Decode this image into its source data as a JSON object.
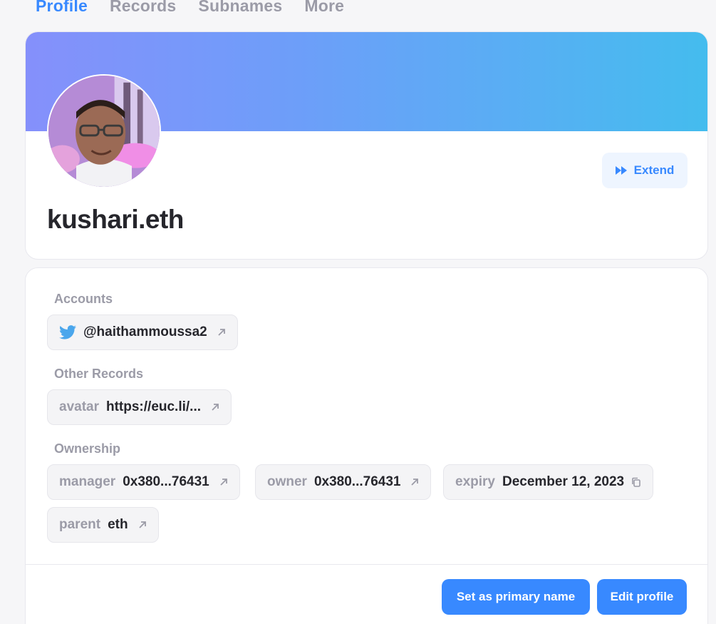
{
  "tabs": [
    {
      "label": "Profile",
      "active": true
    },
    {
      "label": "Records",
      "active": false
    },
    {
      "label": "Subnames",
      "active": false
    },
    {
      "label": "More",
      "active": false
    }
  ],
  "profile": {
    "name": "kushari.eth",
    "extend_label": "Extend",
    "avatar_icon": "profile-photo"
  },
  "accounts": {
    "label": "Accounts",
    "twitter": {
      "icon": "twitter-icon",
      "handle": "@haithammoussa2"
    }
  },
  "other_records": {
    "label": "Other Records",
    "avatar": {
      "key": "avatar",
      "value": "https://euc.li/..."
    }
  },
  "ownership": {
    "label": "Ownership",
    "manager": {
      "key": "manager",
      "value": "0x380...76431"
    },
    "owner": {
      "key": "owner",
      "value": "0x380...76431"
    },
    "expiry": {
      "key": "expiry",
      "value": "December 12, 2023"
    },
    "parent": {
      "key": "parent",
      "value": "eth"
    }
  },
  "actions": {
    "set_primary_label": "Set as primary name",
    "edit_profile_label": "Edit profile"
  },
  "colors": {
    "accent": "#3889ff",
    "banner_start": "#8590fb",
    "banner_end": "#44bcee",
    "muted_text": "#9b9ba7"
  }
}
